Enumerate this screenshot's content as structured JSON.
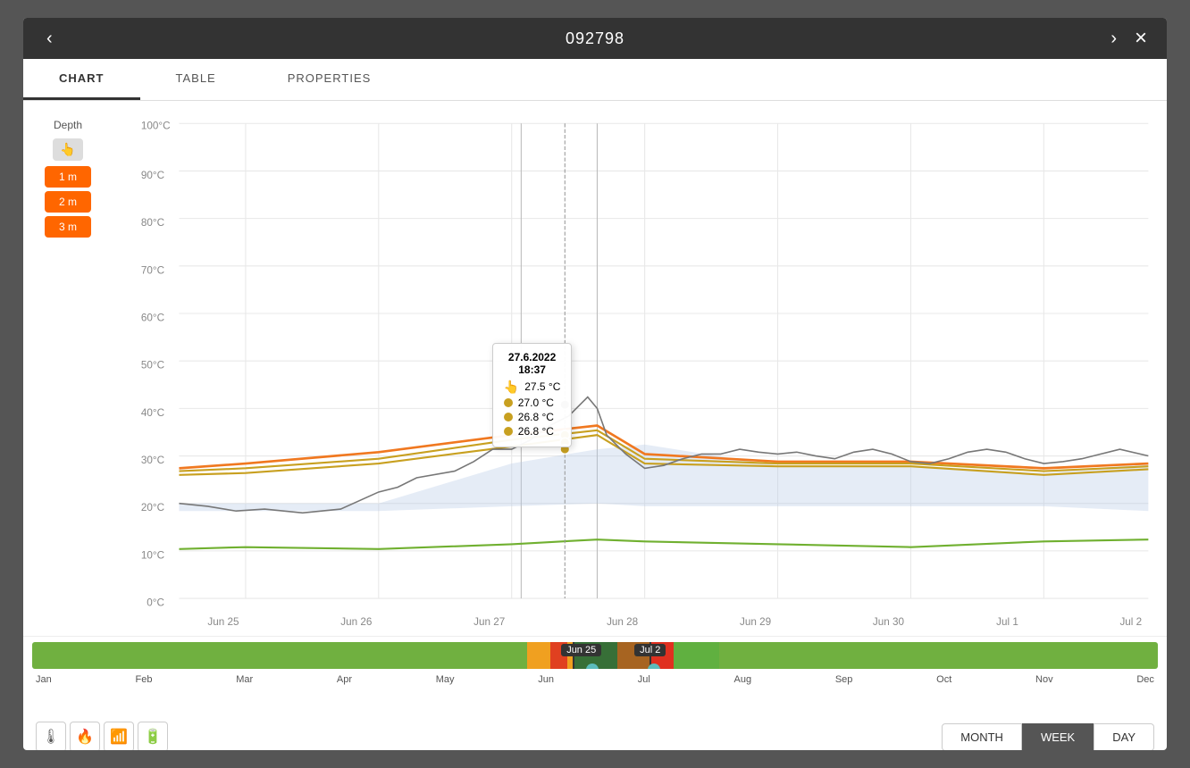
{
  "modal": {
    "title": "092798",
    "close_label": "×",
    "prev_label": "‹",
    "next_label": "›"
  },
  "tabs": [
    {
      "id": "chart",
      "label": "CHART",
      "active": true
    },
    {
      "id": "table",
      "label": "TABLE",
      "active": false
    },
    {
      "id": "properties",
      "label": "PROPERTIES",
      "active": false
    }
  ],
  "depth": {
    "label": "Depth",
    "buttons": [
      {
        "label": "1 m",
        "active": true
      },
      {
        "label": "2 m",
        "active": true
      },
      {
        "label": "3 m",
        "active": true
      }
    ]
  },
  "chart": {
    "y_axis": {
      "labels": [
        "100°C",
        "90°C",
        "80°C",
        "70°C",
        "60°C",
        "50°C",
        "40°C",
        "30°C",
        "20°C",
        "10°C",
        "0°C"
      ]
    },
    "x_axis": {
      "labels": [
        "Jun 25",
        "Jun 26",
        "Jun 27",
        "Jun 28",
        "Jun 29",
        "Jun 30",
        "Jul 1",
        "Jul 2"
      ]
    }
  },
  "tooltip": {
    "date": "27.6.2022",
    "time": "18:37",
    "rows": [
      {
        "color": "#888",
        "value": "27.5 °C",
        "icon": "thermometer"
      },
      {
        "color": "#c8a020",
        "value": "27.0 °C"
      },
      {
        "color": "#c8a020",
        "value": "26.8 °C"
      },
      {
        "color": "#c8a020",
        "value": "26.8 °C"
      }
    ]
  },
  "timeline": {
    "months": [
      "Jan",
      "Feb",
      "Mar",
      "Apr",
      "May",
      "Jun",
      "Jul",
      "Aug",
      "Sep",
      "Oct",
      "Nov",
      "Dec"
    ],
    "range_start": "Jun 25",
    "range_end": "Jul 2"
  },
  "bottom_icons": [
    {
      "name": "thermometer-icon",
      "symbol": "🌡"
    },
    {
      "name": "fire-icon",
      "symbol": "🔥"
    },
    {
      "name": "wifi-icon",
      "symbol": "📶"
    },
    {
      "name": "battery-icon",
      "symbol": "🔋"
    }
  ],
  "period_buttons": [
    {
      "label": "MONTH",
      "active": false
    },
    {
      "label": "WEEK",
      "active": true
    },
    {
      "label": "DAY",
      "active": false
    }
  ],
  "colors": {
    "orange": "#f60",
    "active_tab": "#333",
    "depth_btn": "#f60",
    "area_fill": "rgba(180,200,230,0.35)",
    "line_orange": "#f07820",
    "line_yellow": "#c8a020",
    "line_green": "#70b030",
    "line_gray": "#888"
  }
}
